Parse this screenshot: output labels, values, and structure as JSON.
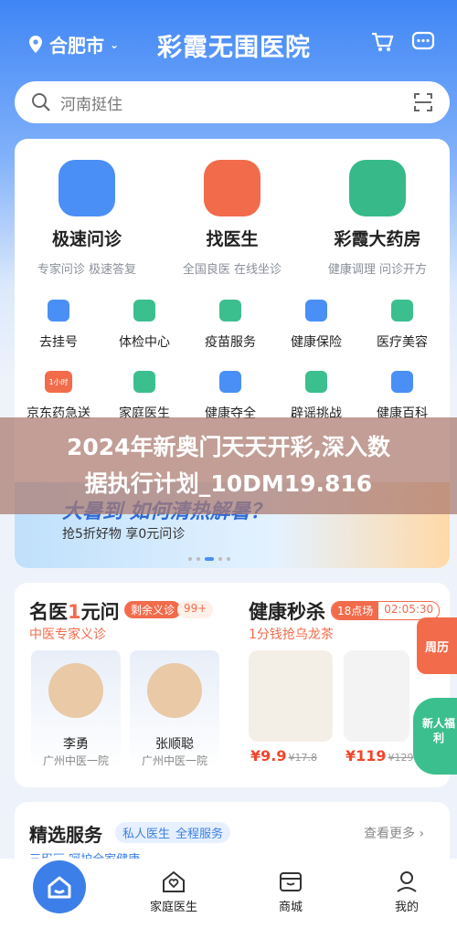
{
  "header": {
    "location": "合肥市",
    "app_title": "彩霞无围医院"
  },
  "search": {
    "placeholder": "河南挺住"
  },
  "main_services": [
    {
      "title": "极速问诊",
      "subtitle": "专家问诊 极速答复",
      "color": "#4a8ff5"
    },
    {
      "title": "找医生",
      "subtitle": "全国良医 在线坐诊",
      "color": "#f26b4b"
    },
    {
      "title": "彩霞大药房",
      "subtitle": "健康调理 问诊开方",
      "color": "#37b98a"
    }
  ],
  "grid_row1": [
    "去挂号",
    "体检中心",
    "疫苗服务",
    "健康保险",
    "医疗美容"
  ],
  "grid_row2": [
    "京东药急送",
    "家庭医生",
    "健康夺全",
    "辟谣挑战",
    "健康百科"
  ],
  "grid_row2_badge": "1小时",
  "banner": {
    "headline": "大暑到 如何清热解暑？",
    "sub": "抢5折好物 享0元问诊"
  },
  "overlay": {
    "line1": "2024年新奥门天天开彩,深入数",
    "line2": "据执行计划_10DM19.816"
  },
  "famous_doctor": {
    "title_a": "名医",
    "title_num": "1",
    "title_b": "元问",
    "badge": "剩余义诊",
    "badge_count": "99+",
    "subtitle": "中医专家义诊",
    "doctors": [
      {
        "name": "李勇",
        "hospital": "广州中医一院"
      },
      {
        "name": "张顺聪",
        "hospital": "广州中医一院"
      }
    ]
  },
  "flash_sale": {
    "title": "健康秒杀",
    "slot": "18点场",
    "countdown": "02:05:30",
    "subtitle": "1分钱抢乌龙茶",
    "items": [
      {
        "price": "¥9.9",
        "orig": "¥17.8"
      },
      {
        "price": "¥119",
        "orig": "¥129"
      }
    ],
    "side_a": "周历",
    "side_b": "新人福利"
  },
  "selected": {
    "title": "精选服务",
    "tags": [
      "私人医生",
      "全程服务"
    ],
    "more": "查看更多",
    "line": "三甲医 呵护全家健康"
  },
  "nav": [
    "家庭医生",
    "商城",
    "我的"
  ]
}
